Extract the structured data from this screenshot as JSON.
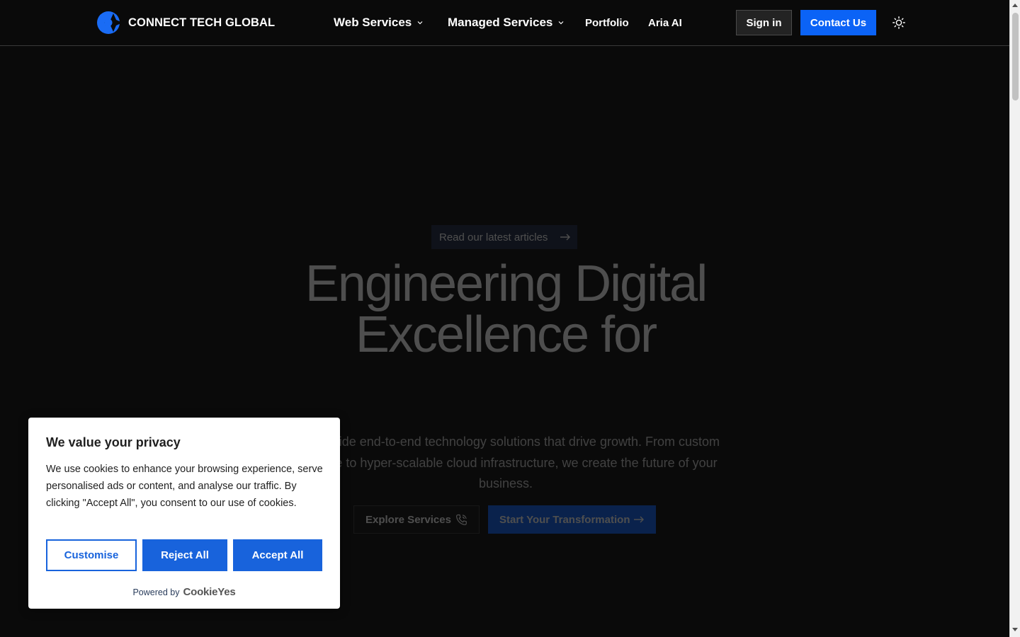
{
  "header": {
    "brand": "CONNECT TECH GLOBAL",
    "nav": [
      {
        "label": "Web Services",
        "has_dropdown": true
      },
      {
        "label": "Managed Services",
        "has_dropdown": true
      },
      {
        "label": "Portfolio",
        "has_dropdown": false
      },
      {
        "label": "Aria AI",
        "has_dropdown": false
      }
    ],
    "sign_in": "Sign in",
    "contact": "Contact Us",
    "theme_toggle_icon": "sun-icon"
  },
  "hero": {
    "pill": "Read our latest articles",
    "title_line1": "Engineering Digital",
    "title_line2": "Excellence for",
    "description": "We provide end-to-end technology solutions that drive growth. From custom software to hyper-scalable cloud infrastructure, we create the future of your business.",
    "explore_button": "Explore Services",
    "start_button": "Start Your Transformation"
  },
  "cookie_banner": {
    "title": "We value your privacy",
    "text": "We use cookies to enhance your browsing experience, serve personalised ads or content, and analyse our traffic. By clicking \"Accept All\", you consent to our use of cookies.",
    "customise": "Customise",
    "reject": "Reject All",
    "accept": "Accept All",
    "powered_by": "Powered by",
    "powered_logo": "CookieYes"
  },
  "colors": {
    "background": "#0a0a0a",
    "accent": "#0b63f6",
    "cookie_accent": "#1863dc"
  }
}
